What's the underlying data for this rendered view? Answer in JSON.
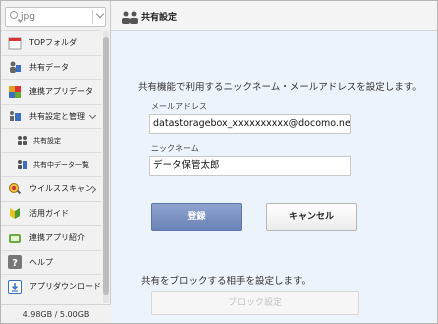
{
  "search": {
    "placeholder": "jpg"
  },
  "sidebar": {
    "items": [
      {
        "label": "TOPフォルダ",
        "icon": "folder-icon"
      },
      {
        "label": "共有データ",
        "icon": "shared-data-icon"
      },
      {
        "label": "連携アプリデータ",
        "icon": "linked-app-data-icon"
      },
      {
        "label": "共有設定と管理",
        "icon": "share-settings-icon",
        "expanded": true
      },
      {
        "label": "共有設定",
        "icon": "users-icon",
        "sub": true
      },
      {
        "label": "共有中データ一覧",
        "icon": "shared-list-icon",
        "sub": true
      },
      {
        "label": "ウイルススキャン",
        "icon": "virus-scan-icon"
      },
      {
        "label": "活用ガイド",
        "icon": "guide-icon"
      },
      {
        "label": "連携アプリ紹介",
        "icon": "app-intro-icon"
      },
      {
        "label": "ヘルプ",
        "icon": "help-icon"
      },
      {
        "label": "アプリダウンロード",
        "icon": "download-icon"
      }
    ],
    "usage": "4.98GB / 5.00GB"
  },
  "header": {
    "title": "共有設定"
  },
  "main": {
    "description": "共有機能で利用するニックネーム・メールアドレスを設定します。",
    "email_label": "メールアドレス",
    "email_value": "datastoragebox_xxxxxxxxxx@docomo.ne.jp",
    "nickname_label": "ニックネーム",
    "nickname_value": "データ保管太郎",
    "register_label": "登録",
    "cancel_label": "キャンセル",
    "block_description": "共有をブロックする相手を設定します。",
    "block_button_label": "ブロック設定"
  },
  "colors": {
    "primary_button": "#7b90c2",
    "content_bg": "#edf3fb",
    "sidebar_bg": "#f1f1f1"
  }
}
